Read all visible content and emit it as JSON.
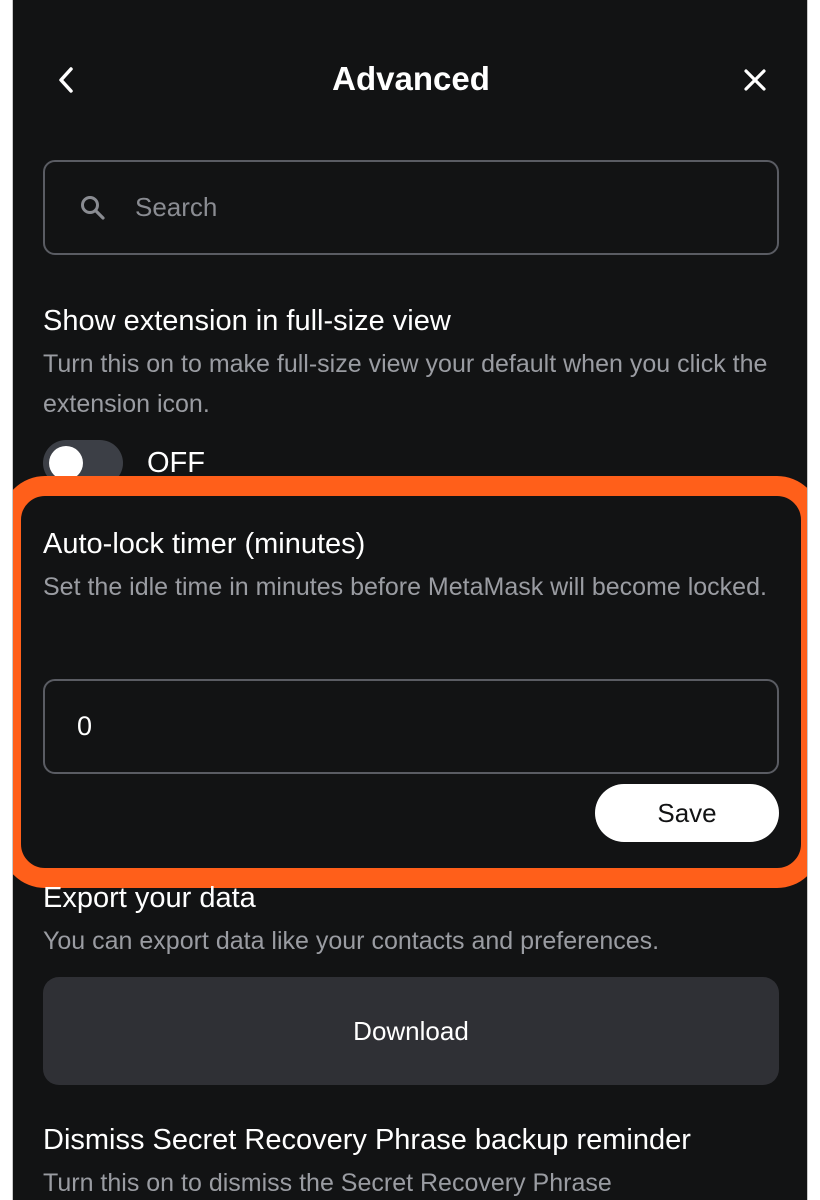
{
  "header": {
    "title": "Advanced",
    "back_icon": "chevron-left-icon",
    "close_icon": "close-icon"
  },
  "search": {
    "placeholder": "Search",
    "value": "",
    "icon": "search-icon"
  },
  "full_size_view": {
    "title": "Show extension in full-size view",
    "description": "Turn this on to make full-size view your default when you click the extension icon.",
    "toggle_state": "OFF"
  },
  "auto_lock": {
    "title": "Auto-lock timer (minutes)",
    "description": "Set the idle time in minutes before MetaMask will become locked.",
    "value": "0",
    "save_label": "Save",
    "highlight_color": "#ff5f1a"
  },
  "export_data": {
    "title": "Export your data",
    "description": "You can export data like your contacts and preferences.",
    "download_label": "Download"
  },
  "srp_reminder": {
    "title": "Dismiss Secret Recovery Phrase backup reminder",
    "description": "Turn this on to dismiss the Secret Recovery Phrase"
  },
  "colors": {
    "background": "#121314",
    "text_primary": "#ffffff",
    "text_secondary": "#9a9ca2",
    "border": "#5a5c63",
    "button_secondary": "#2f3035"
  }
}
